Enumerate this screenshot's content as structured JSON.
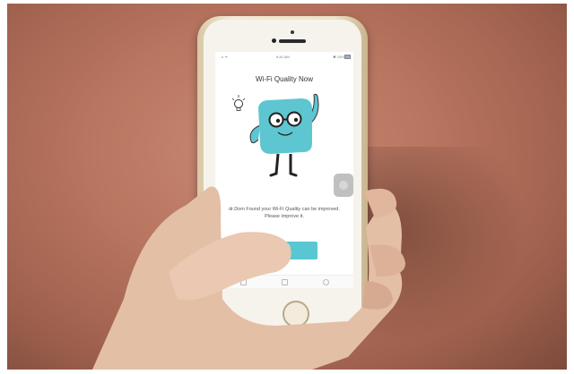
{
  "status_bar": {
    "signal": "..ıl ᯤ",
    "time": "9:41 AM",
    "battery": "✱ 100%"
  },
  "screen": {
    "title": "Wi-Fi Quality Now",
    "message": "dr.Dom Found your Wi-Fi Quality can be improved. Please improve it.",
    "button_label": ""
  },
  "colors": {
    "mascot": "#5ec6d1",
    "button": "#58c7d3",
    "wall": "#b87560",
    "phone_frame": "#efe3c8",
    "skin": "#e8c4ad"
  },
  "icons": [
    "lightbulb-icon",
    "home-tab-icon",
    "list-tab-icon",
    "settings-tab-icon"
  ]
}
